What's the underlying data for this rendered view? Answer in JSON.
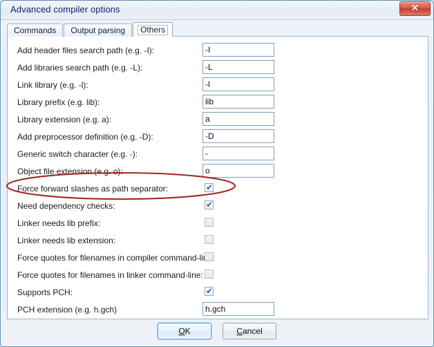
{
  "window": {
    "title": "Advanced compiler options",
    "close_label": "✕"
  },
  "tabs": [
    {
      "label": "Commands",
      "active": false
    },
    {
      "label": "Output parsing",
      "active": false
    },
    {
      "label": "Others",
      "active": true
    }
  ],
  "form": {
    "text_rows": [
      {
        "label": "Add header files search path (e.g. -I):",
        "value": "-I"
      },
      {
        "label": "Add libraries search path (e.g. -L):",
        "value": "-L"
      },
      {
        "label": "Link library (e.g. -l):",
        "value": "-l"
      },
      {
        "label": "Library prefix (e.g. lib):",
        "value": "lib"
      },
      {
        "label": "Library extension (e.g. a):",
        "value": "a"
      },
      {
        "label": "Add preprocessor definition (e.g. -D):",
        "value": "-D"
      },
      {
        "label": "Generic switch character (e.g. -):",
        "value": "-"
      },
      {
        "label": "Object file extension (e.g. o):",
        "value": "o"
      }
    ],
    "check_rows": [
      {
        "label": "Force forward slashes as path separator:",
        "checked": true,
        "enabled": true,
        "highlighted": true
      },
      {
        "label": "Need dependency checks:",
        "checked": true,
        "enabled": true,
        "highlighted": false
      },
      {
        "label": "Linker needs lib prefix:",
        "checked": false,
        "enabled": false,
        "highlighted": false
      },
      {
        "label": "Linker needs lib extension:",
        "checked": false,
        "enabled": false,
        "highlighted": false
      },
      {
        "label": "Force quotes for filenames in compiler command-line:",
        "checked": false,
        "enabled": false,
        "highlighted": false
      },
      {
        "label": "Force quotes for filenames in linker command-line:",
        "checked": false,
        "enabled": false,
        "highlighted": false
      },
      {
        "label": "Supports PCH:",
        "checked": true,
        "enabled": true,
        "highlighted": false
      }
    ],
    "pch_row": {
      "label": "PCH extension (e.g. h.gch)",
      "value": "h.gch"
    },
    "checkmark": "✔"
  },
  "annotation": {
    "shape": "ellipse",
    "color": "#9e2b25",
    "target": "Force forward slashes as path separator:"
  },
  "buttons": [
    {
      "id": "ok",
      "prefix": "",
      "accel": "O",
      "suffix": "K",
      "default": true
    },
    {
      "id": "cancel",
      "prefix": "",
      "accel": "C",
      "suffix": "ancel",
      "default": false
    }
  ]
}
